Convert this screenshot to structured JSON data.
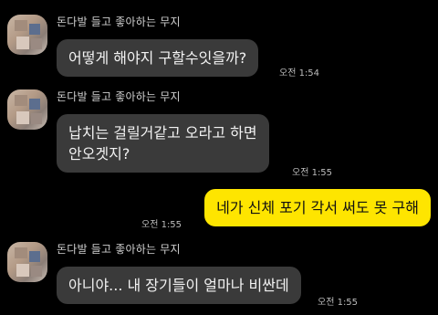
{
  "chat": {
    "messages": [
      {
        "sender": "돈다발 들고 좋아하는 무지",
        "text": "어떻게 해야지 구할수잇을까?",
        "time": "오전 1:54"
      },
      {
        "sender": "돈다발 들고 좋아하는 무지",
        "text": "납치는 걸릴거같고 오라고 하면\n안오겟지?",
        "time": "오전 1:55"
      },
      {
        "text": "네가 신체 포기 각서 써도 못 구해",
        "time": "오전 1:55"
      },
      {
        "sender": "돈다발 들고 좋아하는 무지",
        "text": "아니야... 내 장기들이 얼마나 비싼데",
        "time": "오전 1:55"
      }
    ]
  },
  "colors": {
    "background": "#000000",
    "incoming_bubble": "#3a3a3a",
    "outgoing_bubble": "#fee500"
  },
  "icons": {
    "avatar": "blurred-profile-photo"
  }
}
